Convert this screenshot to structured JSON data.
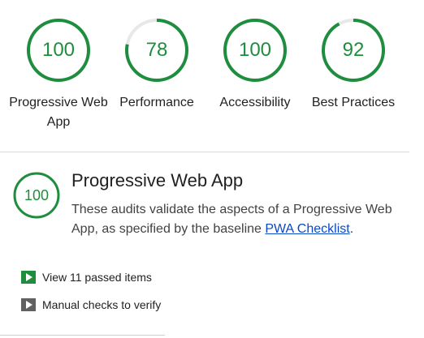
{
  "colors": {
    "pass": "#1e8e3e",
    "track": "#e8e8e8",
    "link": "#0b48c5",
    "manual_arrow": "#616161"
  },
  "categories": [
    {
      "label": "Progressive Web App",
      "score": "100",
      "fraction": 1.0
    },
    {
      "label": "Performance",
      "score": "78",
      "fraction": 0.78
    },
    {
      "label": "Accessibility",
      "score": "100",
      "fraction": 1.0
    },
    {
      "label": "Best Practices",
      "score": "92",
      "fraction": 0.92
    }
  ],
  "section": {
    "score": "100",
    "fraction": 1.0,
    "title": "Progressive Web App",
    "description": "These audits validate the aspects of a Progressive Web App, as specified by the baseline ",
    "link_text": "PWA Checklist",
    "description_end": "."
  },
  "groups": {
    "passed_label": "View 11 passed items",
    "passed_icon": "play-triangle-icon",
    "manual_label": "Manual checks to verify",
    "manual_icon": "play-triangle-icon"
  }
}
